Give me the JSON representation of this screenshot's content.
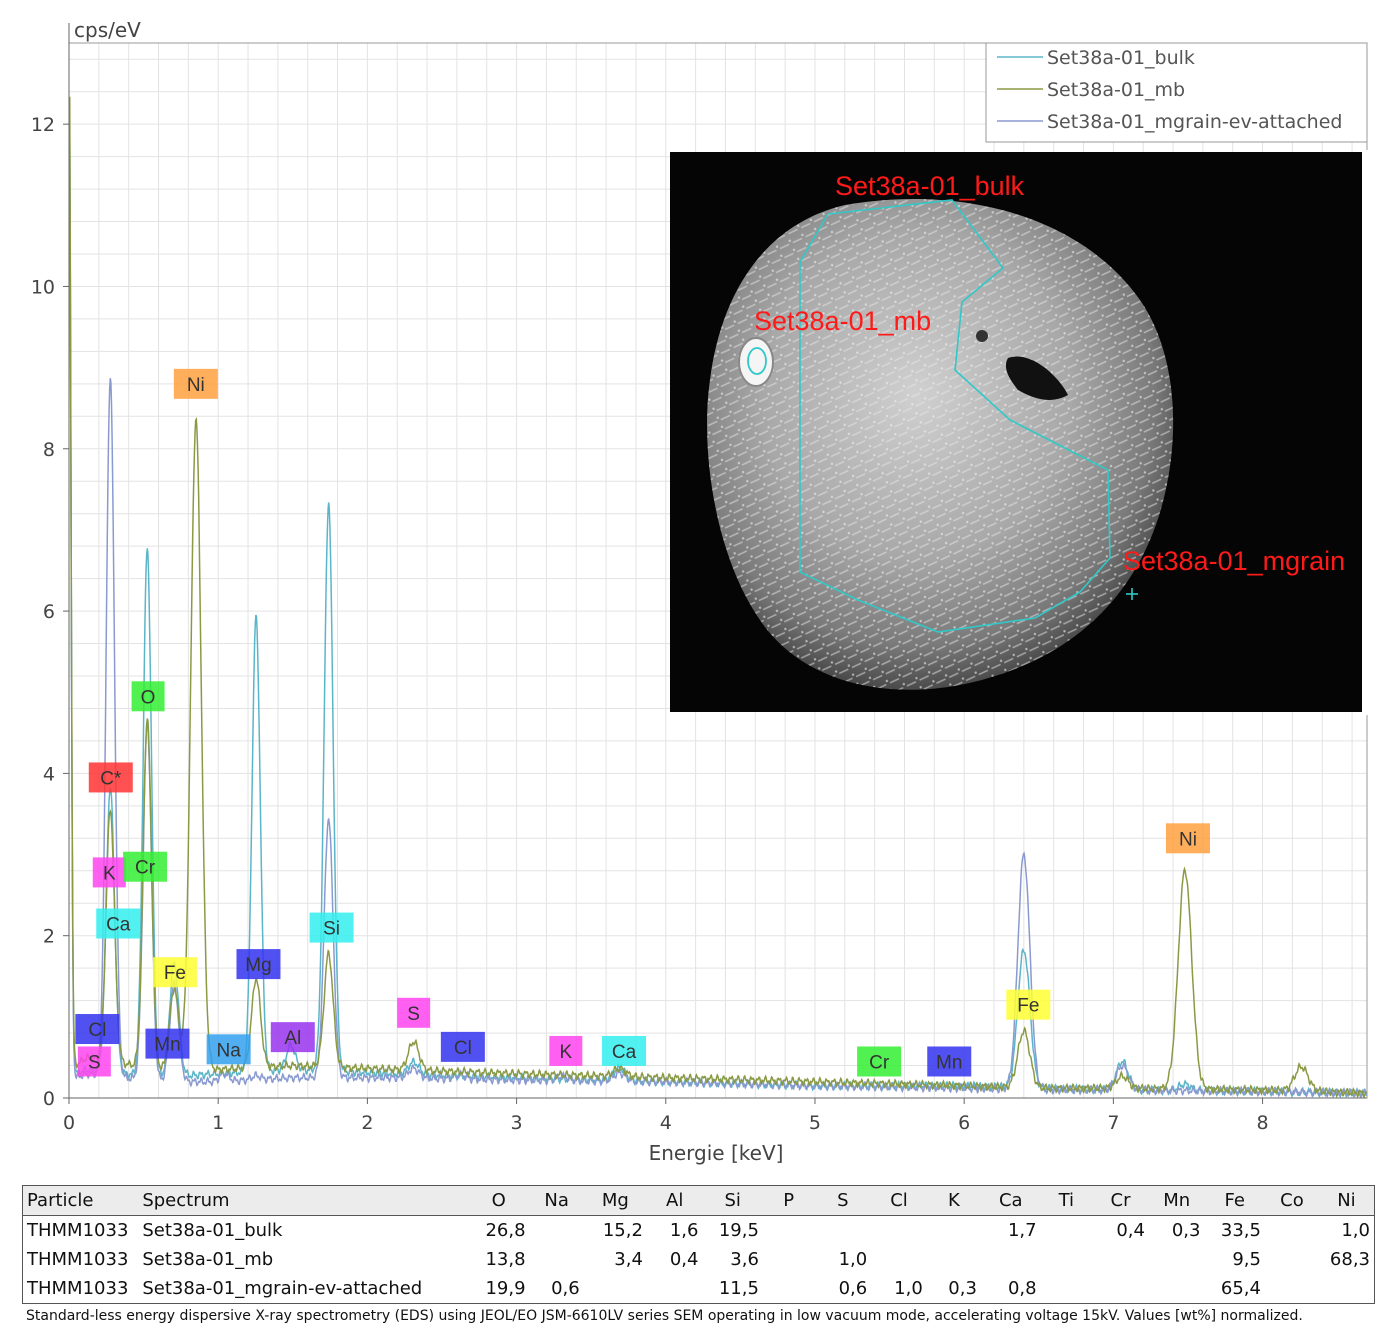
{
  "chart_data": {
    "type": "line",
    "xlabel": "Energie [keV]",
    "ylabel": "cps/eV",
    "xlim": [
      0,
      8.7
    ],
    "ylim": [
      0,
      13
    ],
    "xticks": [
      0,
      1,
      2,
      3,
      4,
      5,
      6,
      7,
      8
    ],
    "yticks": [
      0,
      2,
      4,
      6,
      8,
      10,
      12
    ],
    "grid": true,
    "legend": "top-right",
    "series": [
      {
        "name": "Set38a-01_bulk",
        "color": "#5bb5c8",
        "baseline": [
          [
            0.04,
            0.3
          ],
          [
            0.12,
            0.35
          ],
          [
            0.6,
            0.25
          ],
          [
            1.0,
            0.3
          ],
          [
            1.5,
            0.35
          ],
          [
            2.2,
            0.3
          ],
          [
            3.0,
            0.25
          ],
          [
            4.0,
            0.2
          ],
          [
            5.0,
            0.15
          ],
          [
            6.0,
            0.15
          ],
          [
            6.5,
            0.12
          ],
          [
            7.0,
            0.1
          ],
          [
            8.0,
            0.08
          ],
          [
            8.7,
            0.06
          ]
        ],
        "peaks": [
          [
            0.277,
            3.5,
            0.028
          ],
          [
            0.525,
            6.5,
            0.028
          ],
          [
            0.705,
            1.4,
            0.03
          ],
          [
            1.254,
            5.6,
            0.028
          ],
          [
            1.487,
            0.3,
            0.03
          ],
          [
            1.74,
            7.0,
            0.03
          ],
          [
            2.31,
            0.15,
            0.035
          ],
          [
            3.69,
            0.15,
            0.04
          ],
          [
            6.4,
            1.7,
            0.04
          ],
          [
            7.06,
            0.35,
            0.04
          ],
          [
            7.48,
            0.08,
            0.04
          ]
        ]
      },
      {
        "name": "Set38a-01_mb",
        "color": "#8a9a44",
        "baseline": [
          [
            0.04,
            0.4
          ],
          [
            0.12,
            0.5
          ],
          [
            0.6,
            0.35
          ],
          [
            1.0,
            0.35
          ],
          [
            1.5,
            0.4
          ],
          [
            2.2,
            0.35
          ],
          [
            3.0,
            0.3
          ],
          [
            4.0,
            0.25
          ],
          [
            5.0,
            0.2
          ],
          [
            6.0,
            0.15
          ],
          [
            6.5,
            0.12
          ],
          [
            7.0,
            0.12
          ],
          [
            8.0,
            0.1
          ],
          [
            8.7,
            0.06
          ]
        ],
        "peaks": [
          [
            0.277,
            3.1,
            0.028
          ],
          [
            0.525,
            4.3,
            0.028
          ],
          [
            0.705,
            1.0,
            0.03
          ],
          [
            0.851,
            8.0,
            0.035
          ],
          [
            1.254,
            1.1,
            0.03
          ],
          [
            1.74,
            1.4,
            0.03
          ],
          [
            2.31,
            0.35,
            0.035
          ],
          [
            3.69,
            0.1,
            0.04
          ],
          [
            6.4,
            0.7,
            0.04
          ],
          [
            7.06,
            0.15,
            0.04
          ],
          [
            7.48,
            2.7,
            0.045
          ],
          [
            8.26,
            0.3,
            0.045
          ]
        ]
      },
      {
        "name": "Set38a-01_mgrain-ev-attached",
        "color": "#8a9ad0",
        "baseline": [
          [
            0.04,
            0.25
          ],
          [
            0.12,
            0.3
          ],
          [
            0.6,
            0.2
          ],
          [
            1.0,
            0.2
          ],
          [
            1.5,
            0.25
          ],
          [
            2.2,
            0.25
          ],
          [
            3.0,
            0.22
          ],
          [
            4.0,
            0.2
          ],
          [
            5.0,
            0.15
          ],
          [
            6.0,
            0.12
          ],
          [
            6.5,
            0.1
          ],
          [
            7.0,
            0.1
          ],
          [
            8.0,
            0.08
          ],
          [
            8.7,
            0.06
          ]
        ],
        "peaks": [
          [
            0.277,
            8.6,
            0.028
          ],
          [
            0.525,
            4.4,
            0.028
          ],
          [
            0.705,
            1.2,
            0.03
          ],
          [
            1.04,
            0.1,
            0.03
          ],
          [
            1.254,
            0.05,
            0.03
          ],
          [
            1.74,
            3.2,
            0.03
          ],
          [
            2.31,
            0.12,
            0.035
          ],
          [
            2.62,
            0.05,
            0.035
          ],
          [
            3.31,
            0.05,
            0.04
          ],
          [
            3.69,
            0.1,
            0.04
          ],
          [
            6.4,
            2.9,
            0.04
          ],
          [
            7.06,
            0.3,
            0.04
          ]
        ]
      }
    ],
    "element_labels": [
      {
        "text": "Ni",
        "x": 0.85,
        "y": 8.8,
        "color": "#ffa040"
      },
      {
        "text": "O",
        "x": 0.53,
        "y": 4.95,
        "color": "#33ee33"
      },
      {
        "text": "C*",
        "x": 0.28,
        "y": 3.95,
        "color": "#ff3333"
      },
      {
        "text": "K",
        "x": 0.27,
        "y": 2.78,
        "color": "#ff44ee"
      },
      {
        "text": "Cr",
        "x": 0.51,
        "y": 2.85,
        "color": "#33ee33"
      },
      {
        "text": "Ca",
        "x": 0.33,
        "y": 2.15,
        "color": "#33eeee"
      },
      {
        "text": "Fe",
        "x": 0.71,
        "y": 1.55,
        "color": "#ffff33"
      },
      {
        "text": "Mg",
        "x": 1.27,
        "y": 1.65,
        "color": "#3333ee"
      },
      {
        "text": "Si",
        "x": 1.76,
        "y": 2.1,
        "color": "#33eeee"
      },
      {
        "text": "Cl",
        "x": 0.19,
        "y": 0.85,
        "color": "#3333ee"
      },
      {
        "text": "S",
        "x": 0.17,
        "y": 0.45,
        "color": "#ff44ee"
      },
      {
        "text": "Mn",
        "x": 0.66,
        "y": 0.67,
        "color": "#3333ee"
      },
      {
        "text": "Na",
        "x": 1.07,
        "y": 0.6,
        "color": "#33a0ee"
      },
      {
        "text": "Al",
        "x": 1.5,
        "y": 0.75,
        "color": "#9933ee"
      },
      {
        "text": "S",
        "x": 2.31,
        "y": 1.05,
        "color": "#ff44ee"
      },
      {
        "text": "Cl",
        "x": 2.64,
        "y": 0.63,
        "color": "#3333ee"
      },
      {
        "text": "K",
        "x": 3.33,
        "y": 0.58,
        "color": "#ff44ee"
      },
      {
        "text": "Ca",
        "x": 3.72,
        "y": 0.58,
        "color": "#33eeee"
      },
      {
        "text": "Cr",
        "x": 5.43,
        "y": 0.45,
        "color": "#33ee33"
      },
      {
        "text": "Mn",
        "x": 5.9,
        "y": 0.45,
        "color": "#3333ee"
      },
      {
        "text": "Fe",
        "x": 6.43,
        "y": 1.15,
        "color": "#ffff33"
      },
      {
        "text": "Ni",
        "x": 7.5,
        "y": 3.2,
        "color": "#ffa040"
      }
    ]
  },
  "sem_image": {
    "labels": [
      "Set38a-01_bulk",
      "Set38a-01_mb",
      "Set38a-01_mgrain"
    ]
  },
  "table": {
    "headers": [
      "Particle",
      "Spectrum",
      "O",
      "Na",
      "Mg",
      "Al",
      "Si",
      "P",
      "S",
      "Cl",
      "K",
      "Ca",
      "Ti",
      "Cr",
      "Mn",
      "Fe",
      "Co",
      "Ni"
    ],
    "rows": [
      [
        "THMM1033",
        "Set38a-01_bulk",
        "26,8",
        "",
        "15,2",
        "1,6",
        "19,5",
        "",
        "",
        "",
        "",
        "1,7",
        "",
        "0,4",
        "0,3",
        "33,5",
        "",
        "1,0"
      ],
      [
        "THMM1033",
        "Set38a-01_mb",
        "13,8",
        "",
        "3,4",
        "0,4",
        "3,6",
        "",
        "1,0",
        "",
        "",
        "",
        "",
        "",
        "",
        "9,5",
        "",
        "68,3"
      ],
      [
        "THMM1033",
        "Set38a-01_mgrain-ev-attached",
        "19,9",
        "0,6",
        "",
        "",
        "11,5",
        "",
        "0,6",
        "1,0",
        "0,3",
        "0,8",
        "",
        "",
        "",
        "65,4",
        "",
        ""
      ]
    ]
  },
  "footnote": "Standard-less energy dispersive X-ray spectrometry (EDS) using JEOL/EO JSM-6610LV series SEM operating in low vacuum mode, accelerating voltage 15kV. Values [wt%] normalized."
}
